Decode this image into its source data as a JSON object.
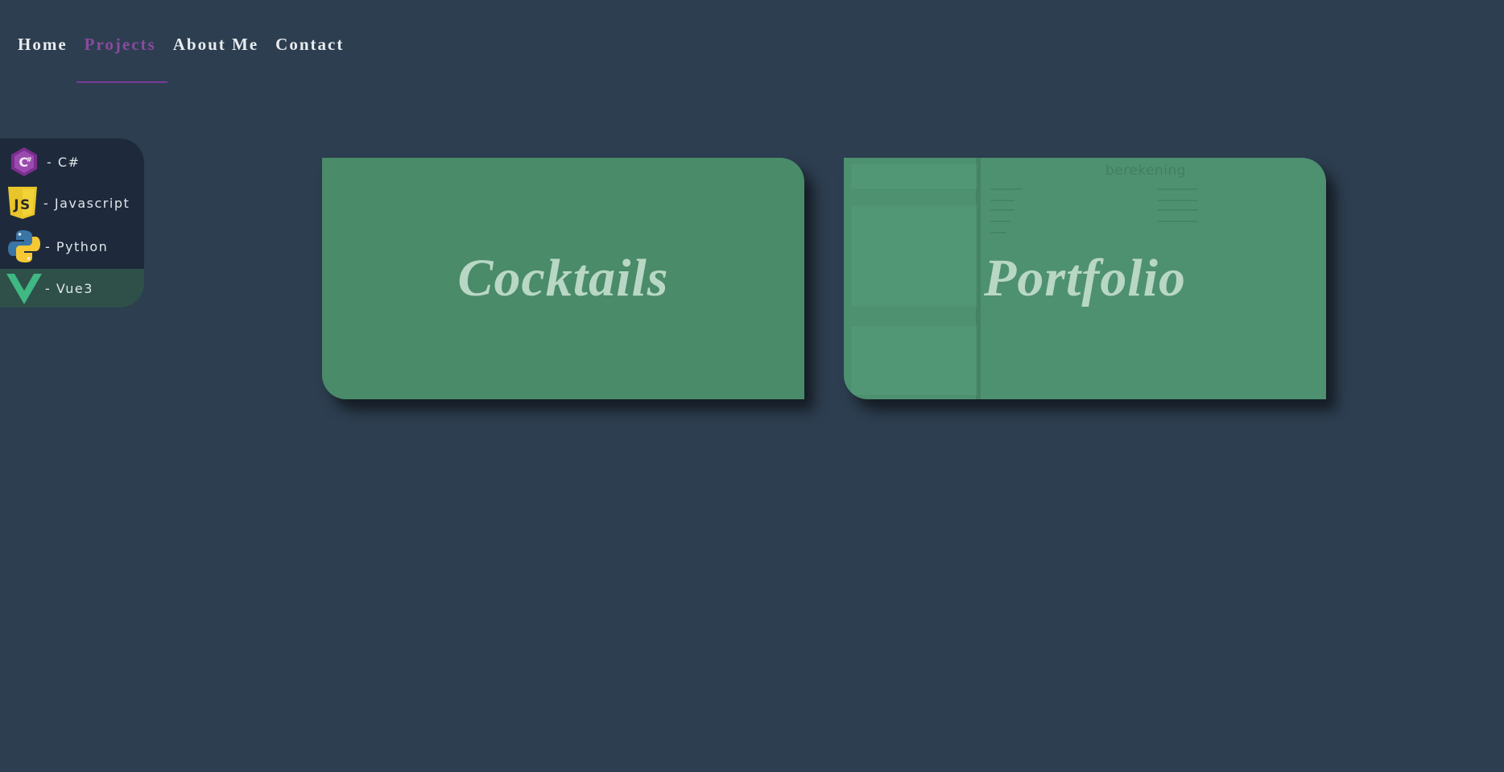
{
  "nav": {
    "items": [
      {
        "label": "Home"
      },
      {
        "label": "Projects"
      },
      {
        "label": "About Me"
      },
      {
        "label": "Contact"
      }
    ],
    "active": "Projects"
  },
  "languages": {
    "items": [
      {
        "label": "- C#",
        "icon": "csharp-icon"
      },
      {
        "label": "- Javascript",
        "icon": "javascript-icon"
      },
      {
        "label": "- Python",
        "icon": "python-icon"
      },
      {
        "label": "- Vue3",
        "icon": "vue-icon"
      }
    ],
    "selected": "- Vue3"
  },
  "projects": {
    "cards": [
      {
        "title": "Cocktails"
      },
      {
        "title": "Portfolio",
        "preview_heading": "berekening"
      }
    ]
  },
  "colors": {
    "background": "#2d3e50",
    "accent": "#8a4a9e",
    "card": "#4a8b69",
    "sidebar": "#1e2a3b"
  }
}
